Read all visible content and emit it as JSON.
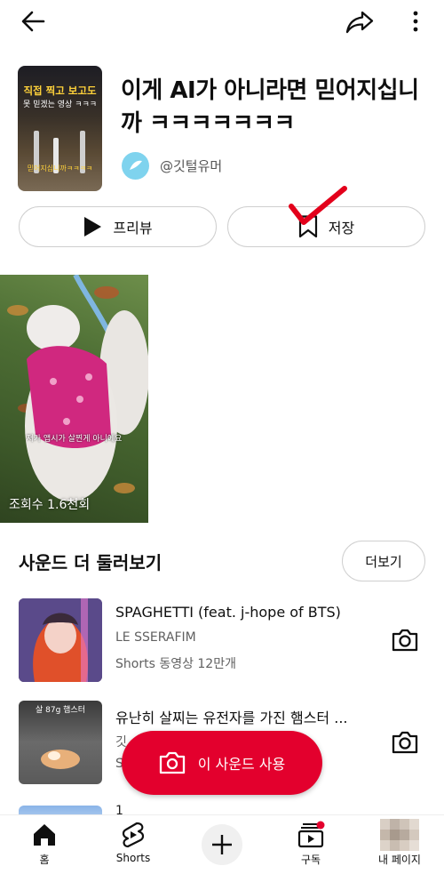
{
  "topbar": {
    "back_icon": "back-arrow-icon",
    "share_icon": "share-icon",
    "more_icon": "more-vertical-icon"
  },
  "sound": {
    "cover_caption_1": "직접 찍고 보고도",
    "cover_caption_2": "못 믿겠는 영상 ㅋㅋㅋ",
    "cover_caption_3": "믿어지십니까ㅋㅋㅋㅋ",
    "title": "이게 AI가 아니라면 믿어지십니까 ㅋㅋㅋㅋㅋㅋㅋ",
    "channel_handle": "@깃털유머"
  },
  "actions": {
    "preview_label": "프리뷰",
    "save_label": "저장"
  },
  "video": {
    "caption": "저가 앱시가 살찐게 아니에요",
    "views": "조회수 1.6천회"
  },
  "more_section": {
    "title": "사운드 더 둘러보기",
    "more_label": "더보기",
    "items": [
      {
        "title": "SPAGHETTI (feat. j-hope of BTS)",
        "artist": "LE SSERAFIM",
        "meta": "Shorts 동영상 12만개"
      },
      {
        "title": "유난히 살찌는 유전자를 가진 햄스터 ...",
        "artist": "깃",
        "meta": "S",
        "thumb_caption": "살 87g 햄스터"
      }
    ],
    "peek_text": "1"
  },
  "use_sound": {
    "label": "이 사운드 사용"
  },
  "nav": {
    "home": "홈",
    "shorts": "Shorts",
    "subscriptions": "구독",
    "my_page": "내 페이지"
  },
  "colors": {
    "accent": "#e3002d",
    "annotation_check": "#e3001b"
  }
}
